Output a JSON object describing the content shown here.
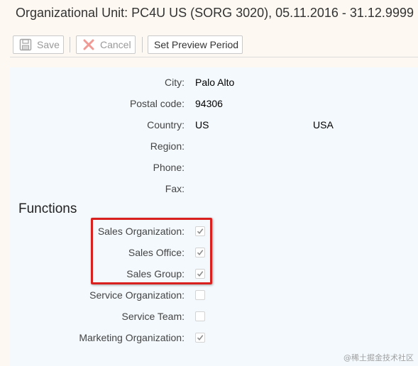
{
  "header": {
    "title": "Organizational Unit: PC4U US (SORG 3020), 05.11.2016 - 31.12.9999"
  },
  "toolbar": {
    "save_label": "Save",
    "cancel_label": "Cancel",
    "preview_label": "Set Preview Period"
  },
  "address": {
    "city_label": "City:",
    "city_value": "Palo Alto",
    "postal_label": "Postal code:",
    "postal_value": "94306",
    "country_label": "Country:",
    "country_code": "US",
    "country_name": "USA",
    "region_label": "Region:",
    "phone_label": "Phone:",
    "fax_label": "Fax:"
  },
  "functions": {
    "title": "Functions",
    "items": [
      {
        "label": "Sales Organization:",
        "checked": true
      },
      {
        "label": "Sales Office:",
        "checked": true
      },
      {
        "label": "Sales Group:",
        "checked": true
      },
      {
        "label": "Service Organization:",
        "checked": false
      },
      {
        "label": "Service Team:",
        "checked": false
      },
      {
        "label": "Marketing Organization:",
        "checked": true
      }
    ]
  },
  "watermark": "@稀土掘金技术社区",
  "colors": {
    "highlight": "#d9201e",
    "panel": "#f3f9fc",
    "page": "#fdf9f2"
  }
}
